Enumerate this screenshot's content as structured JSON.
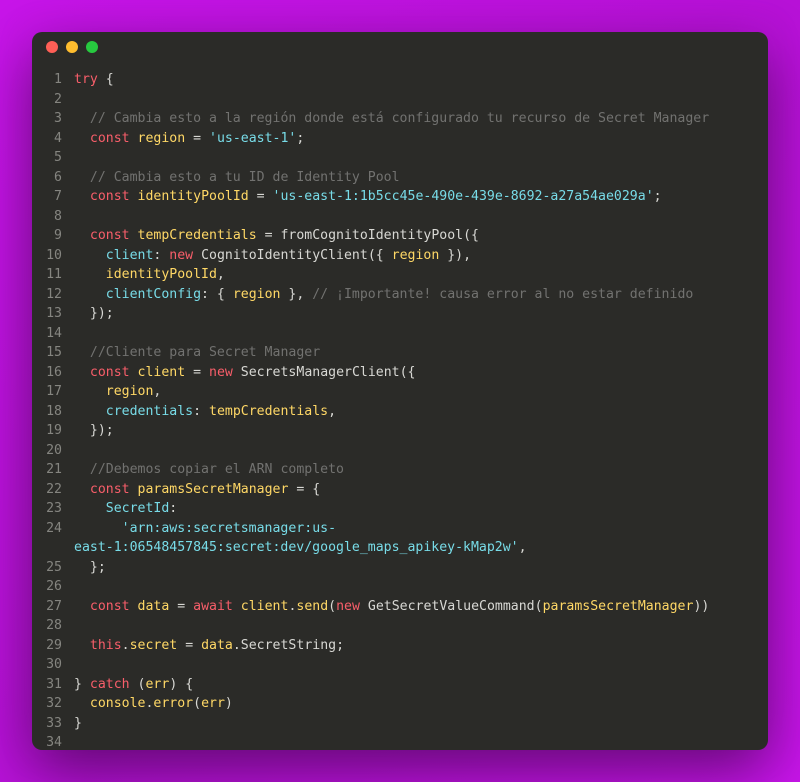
{
  "window": {
    "controls": [
      "close",
      "minimize",
      "maximize"
    ]
  },
  "lines": [
    {
      "n": "1",
      "tokens": [
        [
          "kw",
          "try"
        ],
        [
          "punc",
          " {"
        ]
      ]
    },
    {
      "n": "2",
      "tokens": []
    },
    {
      "n": "3",
      "tokens": [
        [
          "punc",
          "  "
        ],
        [
          "cmt",
          "// Cambia esto a la región donde está configurado tu recurso de Secret Manager"
        ]
      ]
    },
    {
      "n": "4",
      "tokens": [
        [
          "punc",
          "  "
        ],
        [
          "kw",
          "const"
        ],
        [
          "punc",
          " "
        ],
        [
          "var",
          "region"
        ],
        [
          "punc",
          " = "
        ],
        [
          "str",
          "'us-east-1'"
        ],
        [
          "punc",
          ";"
        ]
      ]
    },
    {
      "n": "5",
      "tokens": []
    },
    {
      "n": "6",
      "tokens": [
        [
          "punc",
          "  "
        ],
        [
          "cmt",
          "// Cambia esto a tu ID de Identity Pool"
        ]
      ]
    },
    {
      "n": "7",
      "tokens": [
        [
          "punc",
          "  "
        ],
        [
          "kw",
          "const"
        ],
        [
          "punc",
          " "
        ],
        [
          "var",
          "identityPoolId"
        ],
        [
          "punc",
          " = "
        ],
        [
          "str",
          "'us-east-1:1b5cc45e-490e-439e-8692-a27a54ae029a'"
        ],
        [
          "punc",
          ";"
        ]
      ]
    },
    {
      "n": "8",
      "tokens": []
    },
    {
      "n": "9",
      "tokens": [
        [
          "punc",
          "  "
        ],
        [
          "kw",
          "const"
        ],
        [
          "punc",
          " "
        ],
        [
          "var",
          "tempCredentials"
        ],
        [
          "punc",
          " = "
        ],
        [
          "cls",
          "fromCognitoIdentityPool"
        ],
        [
          "punc",
          "({"
        ]
      ]
    },
    {
      "n": "10",
      "tokens": [
        [
          "punc",
          "    "
        ],
        [
          "prop",
          "client"
        ],
        [
          "punc",
          ": "
        ],
        [
          "kw",
          "new"
        ],
        [
          "punc",
          " "
        ],
        [
          "cls",
          "CognitoIdentityClient"
        ],
        [
          "punc",
          "({ "
        ],
        [
          "var",
          "region"
        ],
        [
          "punc",
          " }),"
        ]
      ]
    },
    {
      "n": "11",
      "tokens": [
        [
          "punc",
          "    "
        ],
        [
          "var",
          "identityPoolId"
        ],
        [
          "punc",
          ","
        ]
      ]
    },
    {
      "n": "12",
      "tokens": [
        [
          "punc",
          "    "
        ],
        [
          "prop",
          "clientConfig"
        ],
        [
          "punc",
          ": { "
        ],
        [
          "var",
          "region"
        ],
        [
          "punc",
          " }, "
        ],
        [
          "cmt",
          "// ¡Importante! causa error al no estar definido"
        ]
      ]
    },
    {
      "n": "13",
      "tokens": [
        [
          "punc",
          "  });"
        ]
      ]
    },
    {
      "n": "14",
      "tokens": []
    },
    {
      "n": "15",
      "tokens": [
        [
          "punc",
          "  "
        ],
        [
          "cmt",
          "//Cliente para Secret Manager"
        ]
      ]
    },
    {
      "n": "16",
      "tokens": [
        [
          "punc",
          "  "
        ],
        [
          "kw",
          "const"
        ],
        [
          "punc",
          " "
        ],
        [
          "var",
          "client"
        ],
        [
          "punc",
          " = "
        ],
        [
          "kw",
          "new"
        ],
        [
          "punc",
          " "
        ],
        [
          "cls",
          "SecretsManagerClient"
        ],
        [
          "punc",
          "({"
        ]
      ]
    },
    {
      "n": "17",
      "tokens": [
        [
          "punc",
          "    "
        ],
        [
          "var",
          "region"
        ],
        [
          "punc",
          ","
        ]
      ]
    },
    {
      "n": "18",
      "tokens": [
        [
          "punc",
          "    "
        ],
        [
          "prop",
          "credentials"
        ],
        [
          "punc",
          ": "
        ],
        [
          "var",
          "tempCredentials"
        ],
        [
          "punc",
          ","
        ]
      ]
    },
    {
      "n": "19",
      "tokens": [
        [
          "punc",
          "  });"
        ]
      ]
    },
    {
      "n": "20",
      "tokens": []
    },
    {
      "n": "21",
      "tokens": [
        [
          "punc",
          "  "
        ],
        [
          "cmt",
          "//Debemos copiar el ARN completo"
        ]
      ]
    },
    {
      "n": "22",
      "tokens": [
        [
          "punc",
          "  "
        ],
        [
          "kw",
          "const"
        ],
        [
          "punc",
          " "
        ],
        [
          "var",
          "paramsSecretManager"
        ],
        [
          "punc",
          " = {"
        ]
      ]
    },
    {
      "n": "23",
      "tokens": [
        [
          "punc",
          "    "
        ],
        [
          "prop",
          "SecretId"
        ],
        [
          "punc",
          ":"
        ]
      ]
    },
    {
      "n": "24",
      "tokens": [
        [
          "punc",
          "      "
        ],
        [
          "str",
          "'arn:aws:secretsmanager:us-"
        ]
      ]
    },
    {
      "n": "",
      "tokens": [
        [
          "str",
          "east-1:06548457845:secret:dev/google_maps_apikey-kMap2w'"
        ],
        [
          "punc",
          ","
        ]
      ]
    },
    {
      "n": "25",
      "tokens": [
        [
          "punc",
          "  };"
        ]
      ]
    },
    {
      "n": "26",
      "tokens": []
    },
    {
      "n": "27",
      "tokens": [
        [
          "punc",
          "  "
        ],
        [
          "kw",
          "const"
        ],
        [
          "punc",
          " "
        ],
        [
          "var",
          "data"
        ],
        [
          "punc",
          " = "
        ],
        [
          "kw",
          "await"
        ],
        [
          "punc",
          " "
        ],
        [
          "var",
          "client"
        ],
        [
          "punc",
          "."
        ],
        [
          "fn",
          "send"
        ],
        [
          "punc",
          "("
        ],
        [
          "kw",
          "new"
        ],
        [
          "punc",
          " "
        ],
        [
          "cls",
          "GetSecretValueCommand"
        ],
        [
          "punc",
          "("
        ],
        [
          "var",
          "paramsSecretManager"
        ],
        [
          "punc",
          "))"
        ]
      ]
    },
    {
      "n": "28",
      "tokens": []
    },
    {
      "n": "29",
      "tokens": [
        [
          "punc",
          "  "
        ],
        [
          "this",
          "this"
        ],
        [
          "punc",
          "."
        ],
        [
          "var",
          "secret"
        ],
        [
          "punc",
          " = "
        ],
        [
          "var",
          "data"
        ],
        [
          "punc",
          "."
        ],
        [
          "cls",
          "SecretString"
        ],
        [
          "punc",
          ";"
        ]
      ]
    },
    {
      "n": "30",
      "tokens": []
    },
    {
      "n": "31",
      "tokens": [
        [
          "punc",
          "} "
        ],
        [
          "kw",
          "catch"
        ],
        [
          "punc",
          " ("
        ],
        [
          "var",
          "err"
        ],
        [
          "punc",
          ") {"
        ]
      ]
    },
    {
      "n": "32",
      "tokens": [
        [
          "punc",
          "  "
        ],
        [
          "var",
          "console"
        ],
        [
          "punc",
          "."
        ],
        [
          "fn",
          "error"
        ],
        [
          "punc",
          "("
        ],
        [
          "var",
          "err"
        ],
        [
          "punc",
          ")"
        ]
      ]
    },
    {
      "n": "33",
      "tokens": [
        [
          "punc",
          "}"
        ]
      ]
    },
    {
      "n": "34",
      "tokens": []
    }
  ]
}
